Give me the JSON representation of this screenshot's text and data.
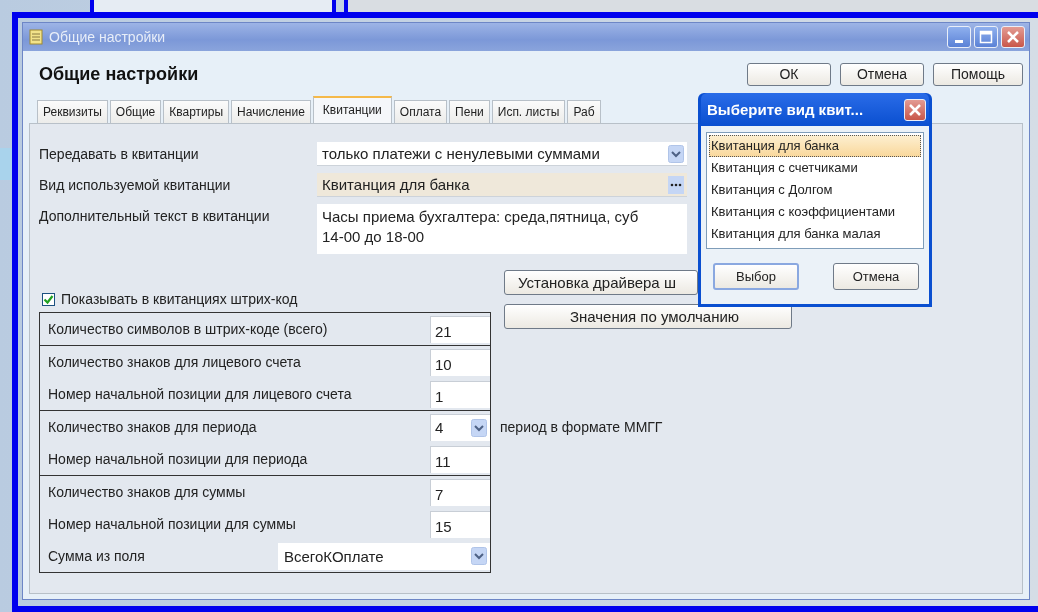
{
  "window": {
    "title": "Общие настройки",
    "heading": "Общие настройки"
  },
  "buttons": [
    {
      "label": "ОК"
    },
    {
      "label": "Отмена"
    },
    {
      "label": "Помощь"
    }
  ],
  "tabs": [
    {
      "label": "Реквизиты",
      "selected": false
    },
    {
      "label": "Общие",
      "selected": false
    },
    {
      "label": "Квартиры",
      "selected": false
    },
    {
      "label": "Начисление",
      "selected": false
    },
    {
      "label": "Квитанции",
      "selected": true
    },
    {
      "label": "Оплата",
      "selected": false
    },
    {
      "label": "Пени",
      "selected": false
    },
    {
      "label": "Исп. листы",
      "selected": false
    },
    {
      "label": "Раб",
      "selected": false
    }
  ],
  "fields": [
    {
      "kind": "dropdown",
      "label": "Передавать в квитанции",
      "value": "только платежи с ненулевыми суммами"
    },
    {
      "kind": "picker",
      "label": "Вид используемой квитанции",
      "value": "Квитанция для банка"
    },
    {
      "kind": "memo",
      "label": "Дополнительный текст в квитанции",
      "lines": [
        "Часы приема бухгалтера: среда,пятница, суб",
        "14-00 до 18-00"
      ]
    }
  ],
  "barcode_checkbox": {
    "label": "Показывать в квитанциях штрих-код",
    "checked": true
  },
  "side_buttons": [
    {
      "label": "Установка драйвера ш"
    },
    {
      "label": "Значения по умолчанию"
    }
  ],
  "barcode_groups": [
    [
      {
        "kind": "number",
        "label": "Количество символов в штрих-коде (всего)",
        "value": "21"
      }
    ],
    [
      {
        "kind": "number",
        "label": "Количество знаков для лицевого счета",
        "value": "10"
      },
      {
        "kind": "number",
        "label": "Номер начальной позиции для лицевого счета",
        "value": "1"
      }
    ],
    [
      {
        "kind": "dropdown",
        "label": "Количество знаков для периода",
        "value": "4",
        "note": "период в формате ММГГ"
      },
      {
        "kind": "number",
        "label": "Номер начальной позиции для периода",
        "value": "11"
      }
    ],
    [
      {
        "kind": "number",
        "label": "Количество знаков для суммы",
        "value": "7"
      },
      {
        "kind": "number",
        "label": "Номер начальной позиции для суммы",
        "value": "15"
      },
      {
        "kind": "wide_dropdown",
        "label": "Сумма из поля",
        "value": "ВсегоКОплате"
      }
    ]
  ],
  "dialog": {
    "title": "Выберите вид квит...",
    "items": [
      {
        "label": "Квитанция для банка",
        "selected": true
      },
      {
        "label": "Квитанция с счетчиками",
        "selected": false
      },
      {
        "label": "Квитанция с Долгом",
        "selected": false
      },
      {
        "label": "Квитанция с коэффициентами",
        "selected": false
      },
      {
        "label": "Квитанция для банка малая",
        "selected": false
      }
    ],
    "buttons": [
      {
        "label": "Выбор"
      },
      {
        "label": "Отмена"
      }
    ]
  }
}
